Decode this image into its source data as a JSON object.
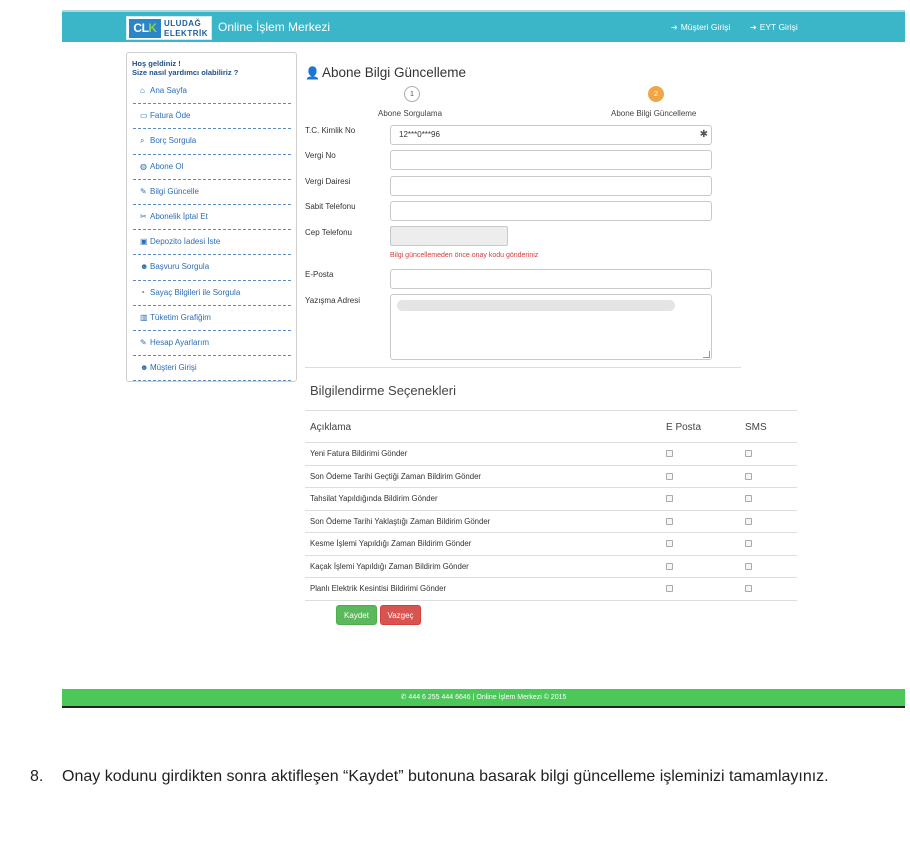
{
  "header": {
    "logo_mark": "CLK",
    "logo_line1": "ULUDAĞ",
    "logo_line2": "ELEKTRİK",
    "site_title": "Online İşlem Merkezi",
    "links": [
      {
        "label": "Müşteri Girişi",
        "icon": "sign-in-icon"
      },
      {
        "label": "EYT Girişi",
        "icon": "sign-in-icon"
      }
    ]
  },
  "sidebar": {
    "greeting1": "Hoş geldiniz !",
    "greeting2": "Size nasıl yardımcı olabiliriz ?",
    "items": [
      {
        "label": "Ana Sayfa",
        "icon": "home-icon",
        "glyph": "⌂"
      },
      {
        "label": "Fatura Öde",
        "icon": "credit-card-icon",
        "glyph": "▭"
      },
      {
        "label": "Borç Sorgula",
        "icon": "search-icon",
        "glyph": "⌕"
      },
      {
        "label": "Abone Ol",
        "icon": "globe-icon",
        "glyph": "◍"
      },
      {
        "label": "Bilgi Güncelle",
        "icon": "edit-icon",
        "glyph": "✎"
      },
      {
        "label": "Abonelik İptal Et",
        "icon": "scissors-icon",
        "glyph": "✂"
      },
      {
        "label": "Depozito İadesi İste",
        "icon": "money-icon",
        "glyph": "▣"
      },
      {
        "label": "Başvuru Sorgula",
        "icon": "user-plus-icon",
        "glyph": "☻"
      },
      {
        "label": "Sayaç Bilgileri ile Sorgula",
        "icon": "dashboard-icon",
        "glyph": "◔"
      },
      {
        "label": "Tüketim Grafiğim",
        "icon": "bar-chart-icon",
        "glyph": "▥"
      },
      {
        "label": "Hesap Ayarlarım",
        "icon": "edit-icon",
        "glyph": "✎"
      },
      {
        "label": "Müşteri Girişi",
        "icon": "users-icon",
        "glyph": "☻"
      }
    ]
  },
  "main": {
    "title": "Abone Bilgi Güncelleme",
    "steps": [
      {
        "number": "1",
        "label": "Abone Sorgulama"
      },
      {
        "number": "2",
        "label": "Abone Bilgi Güncelleme"
      }
    ],
    "fields": {
      "tc_label": "T.C. Kimlik No",
      "tc_value": "12***0***96",
      "required_mark": "✱",
      "vergi_no_label": "Vergi No",
      "vergi_dairesi_label": "Vergi Dairesi",
      "sabit_tel_label": "Sabit Telefonu",
      "cep_tel_label": "Cep Telefonu",
      "cep_warning": "Bilgi güncellemeden önce onay kodu gönderiniz",
      "eposta_label": "E-Posta",
      "adres_label": "Yazışma Adresi"
    },
    "notifications": {
      "title": "Bilgilendirme Seçenekleri",
      "col_desc": "Açıklama",
      "col_email": "E Posta",
      "col_sms": "SMS",
      "rows": [
        "Yeni Fatura Bildirimi Gönder",
        "Son Ödeme Tarihi Geçtiği Zaman Bildirim Gönder",
        "Tahsilat Yapıldığında Bildirim Gönder",
        "Son Ödeme Tarihi Yaklaştığı Zaman Bildirim Gönder",
        "Kesme İşlemi Yapıldığı Zaman Bildirim Gönder",
        "Kaçak İşlemi Yapıldığı Zaman Bildirim Gönder",
        "Planlı Elektrik Kesintisi Bildirimi Gönder"
      ]
    },
    "buttons": {
      "save": "Kaydet",
      "cancel": "Vazgeç"
    }
  },
  "footer": {
    "text": "✆ 444 6 255 444 6646 | Online İşlem Merkezi © 2015"
  },
  "caption": {
    "number": "8.",
    "text": "Onay kodunu girdikten sonra aktifleşen “Kaydet” butonuna basarak bilgi güncelleme işleminizi tamamlayınız."
  },
  "colors": {
    "topbar": "#3bb6c8",
    "footer": "#4cc75a",
    "save_button": "#5cb85c",
    "cancel_button": "#d9534f",
    "active_step": "#f0a646",
    "link": "#2d6db5"
  }
}
